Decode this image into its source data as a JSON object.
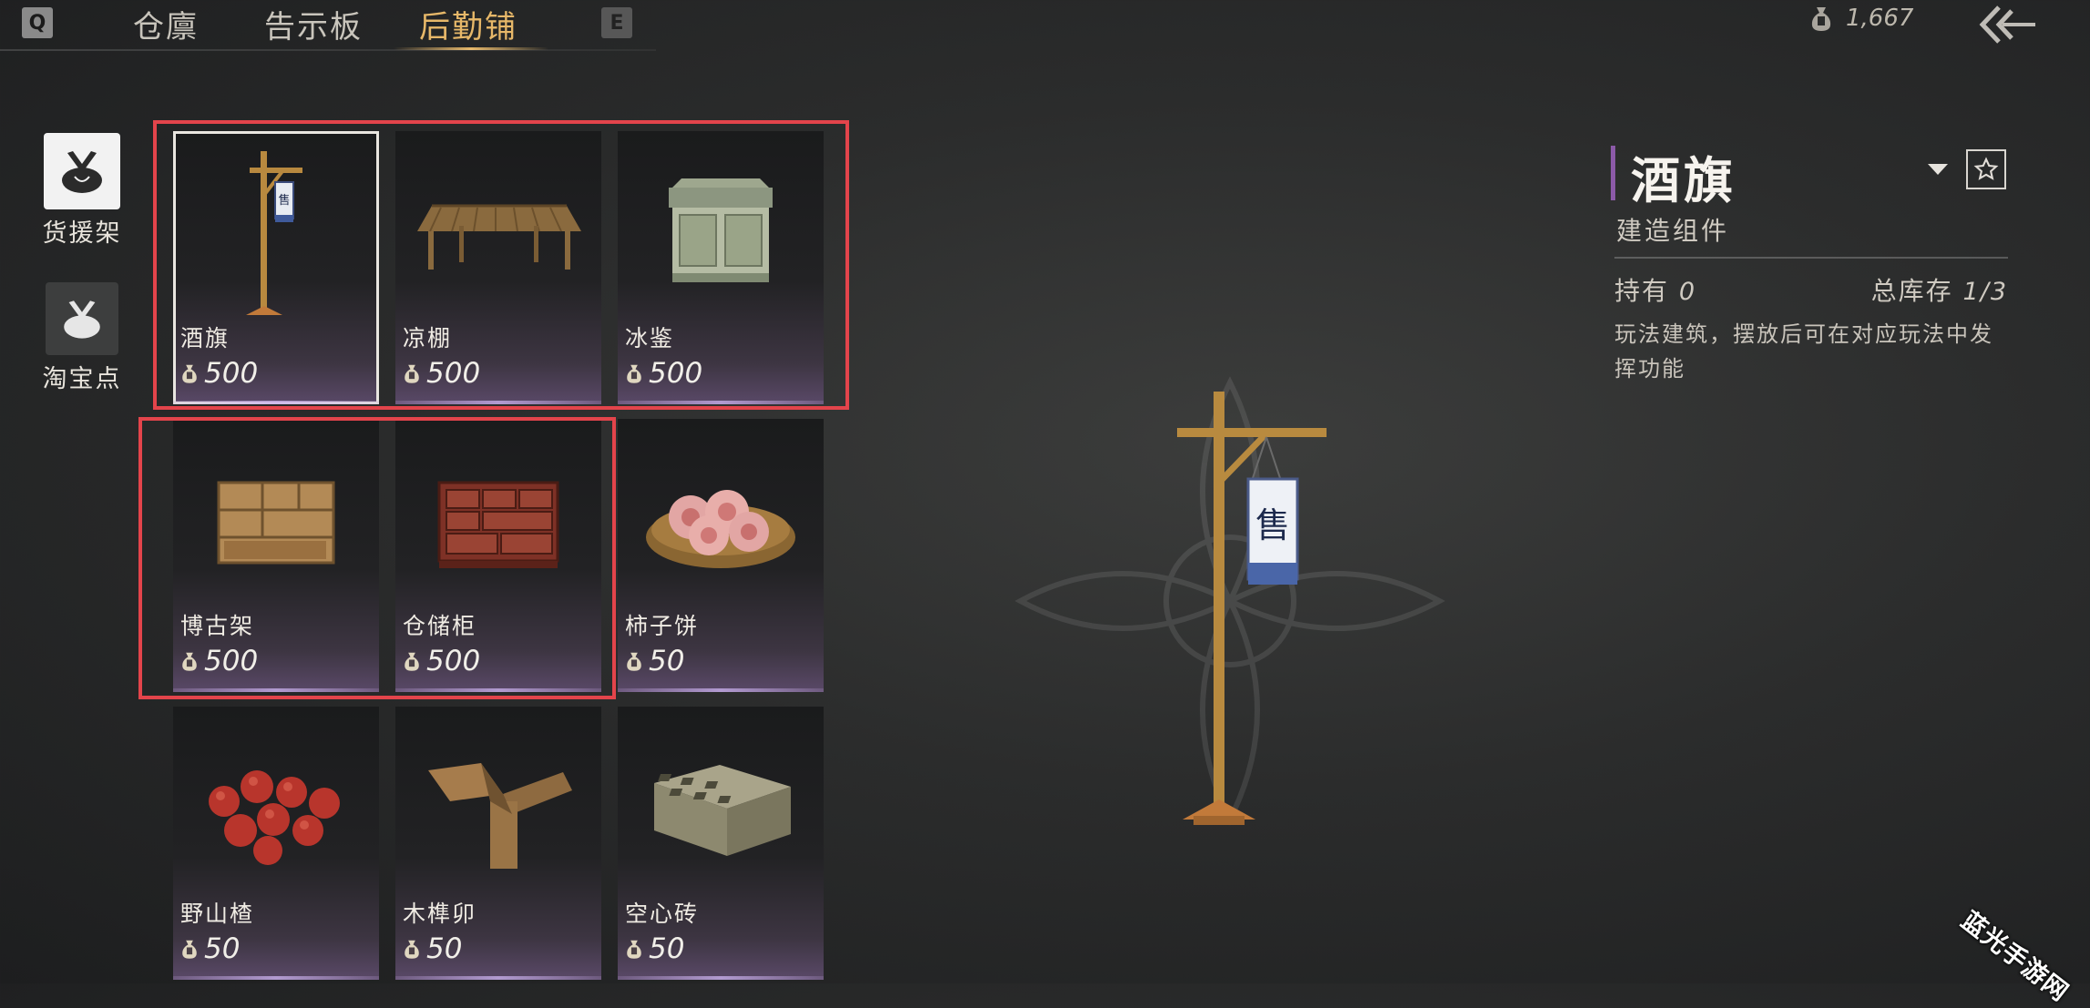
{
  "nav": {
    "left_key": "Q",
    "right_key": "E",
    "tabs": [
      {
        "label": "仓廪"
      },
      {
        "label": "告示板"
      },
      {
        "label": "后勤铺"
      }
    ],
    "active_tab": "后勤铺"
  },
  "currency": {
    "icon": "money-bag-icon",
    "value": "1,667"
  },
  "categories": [
    {
      "label": "货援架",
      "active": true
    },
    {
      "label": "淘宝点",
      "active": false
    }
  ],
  "items": [
    {
      "name": "酒旗",
      "price": "500",
      "icon": "wine-banner-icon"
    },
    {
      "name": "凉棚",
      "price": "500",
      "icon": "pavilion-icon"
    },
    {
      "name": "冰鉴",
      "price": "500",
      "icon": "ice-chest-icon"
    },
    {
      "name": "博古架",
      "price": "500",
      "icon": "curio-shelf-icon"
    },
    {
      "name": "仓储柜",
      "price": "500",
      "icon": "storage-cabinet-icon"
    },
    {
      "name": "柿子饼",
      "price": "50",
      "icon": "persimmon-cake-icon"
    },
    {
      "name": "野山楂",
      "price": "50",
      "icon": "hawthorn-icon"
    },
    {
      "name": "木榫卯",
      "price": "50",
      "icon": "mortise-tenon-icon"
    },
    {
      "name": "空心砖",
      "price": "50",
      "icon": "hollow-brick-icon"
    }
  ],
  "detail": {
    "title": "酒旗",
    "subtitle": "建造组件",
    "hold_label": "持有",
    "hold_value": "0",
    "stock_label": "总库存",
    "stock_value": "1/3",
    "description": "玩法建筑，摆放后可在对应玩法中发挥功能"
  },
  "watermark": "蓝光手游网",
  "colors": {
    "accent_gold": "#e7b869",
    "highlight_red": "#e3444b",
    "title_bar_purple": "#8c5aa8"
  }
}
